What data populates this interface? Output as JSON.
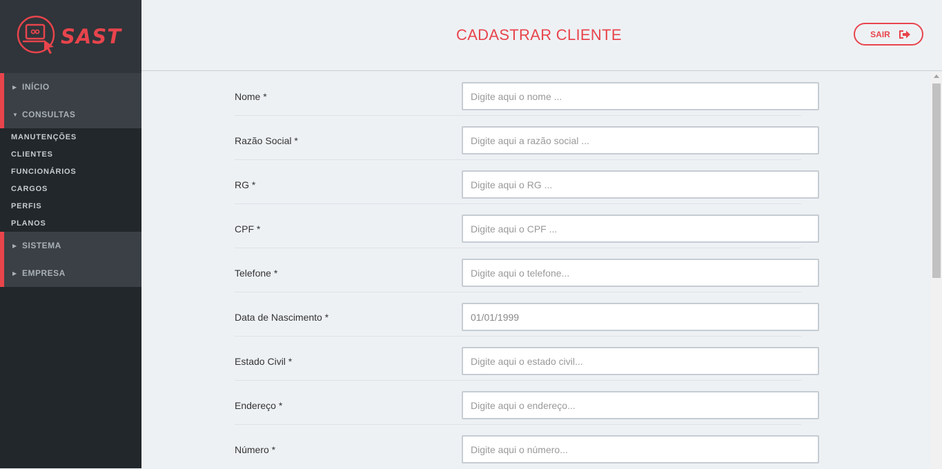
{
  "brand": {
    "name": "SAST",
    "accent": "#e8444c"
  },
  "sidebar": {
    "sections": [
      {
        "label": "INÍCIO",
        "expanded": false
      },
      {
        "label": "CONSULTAS",
        "expanded": true
      },
      {
        "label": "SISTEMA",
        "expanded": false
      },
      {
        "label": "EMPRESA",
        "expanded": false
      }
    ],
    "consultas_items": [
      {
        "label": "MANUTENÇÕES"
      },
      {
        "label": "CLIENTES"
      },
      {
        "label": "FUNCIONÁRIOS"
      },
      {
        "label": "CARGOS"
      },
      {
        "label": "PERFIS"
      },
      {
        "label": "PLANOS"
      }
    ]
  },
  "header": {
    "title": "CADASTRAR CLIENTE",
    "logout_label": "SAIR",
    "logout_icon": "sign-out-icon"
  },
  "form": {
    "fields": [
      {
        "label": "Nome *",
        "value": "",
        "placeholder": "Digite aqui o nome ..."
      },
      {
        "label": "Razão Social *",
        "value": "",
        "placeholder": "Digite aqui a razão social ..."
      },
      {
        "label": "RG *",
        "value": "",
        "placeholder": "Digite aqui o RG ..."
      },
      {
        "label": "CPF *",
        "value": "",
        "placeholder": "Digite aqui o CPF ..."
      },
      {
        "label": "Telefone *",
        "value": "",
        "placeholder": "Digite aqui o telefone..."
      },
      {
        "label": "Data de Nascimento *",
        "value": "01/01/1999",
        "placeholder": ""
      },
      {
        "label": "Estado Civil *",
        "value": "",
        "placeholder": "Digite aqui o estado civil..."
      },
      {
        "label": "Endereço *",
        "value": "",
        "placeholder": "Digite aqui o endereço..."
      },
      {
        "label": "Número *",
        "value": "",
        "placeholder": "Digite aqui o número..."
      }
    ]
  }
}
